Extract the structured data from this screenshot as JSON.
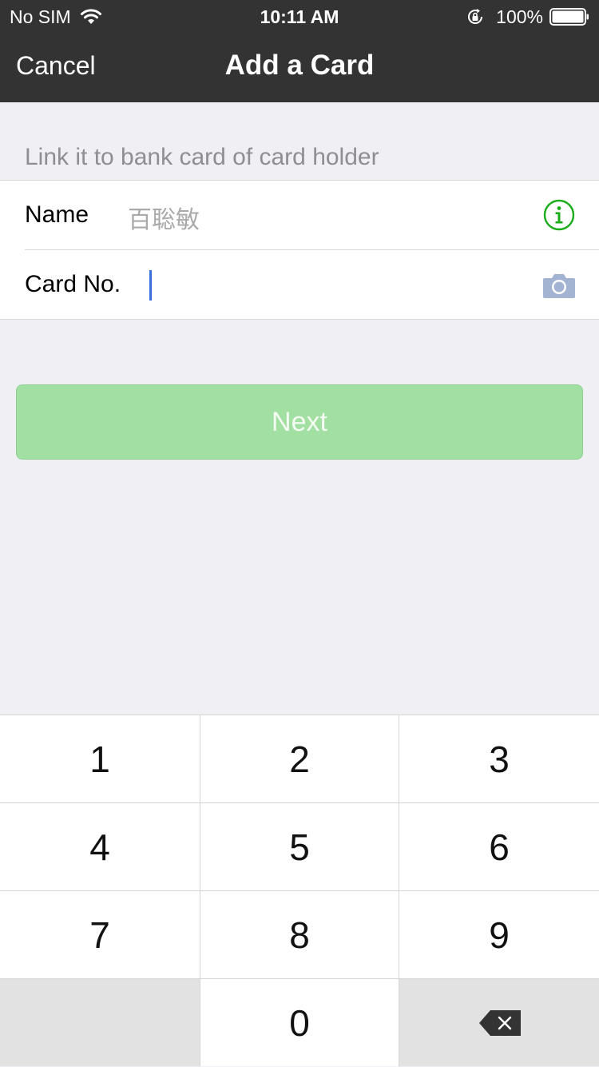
{
  "status_bar": {
    "carrier": "No SIM",
    "time": "10:11 AM",
    "battery_percent": "100%",
    "battery_level": 1.0
  },
  "nav": {
    "cancel_label": "Cancel",
    "title": "Add a Card"
  },
  "form": {
    "caption": "Link it to bank card of card holder",
    "name_label": "Name",
    "name_value": "百聡敏",
    "card_label": "Card No.",
    "card_value": ""
  },
  "next_button": {
    "label": "Next",
    "enabled": false
  },
  "keypad": {
    "keys": [
      "1",
      "2",
      "3",
      "4",
      "5",
      "6",
      "7",
      "8",
      "9",
      "0"
    ]
  },
  "colors": {
    "nav_background": "#333334",
    "page_background": "#EFEFF4",
    "accent_green": "#1AAD19",
    "next_disabled": "#A2DFA2",
    "camera_icon": "#A3B4D2",
    "caret": "#3B6FE0"
  },
  "icons": {
    "wifi": "wifi-icon",
    "orientation_lock": "orientation-lock-icon",
    "battery": "battery-icon",
    "info": "info-icon",
    "camera": "camera-icon",
    "delete": "backspace-icon"
  }
}
